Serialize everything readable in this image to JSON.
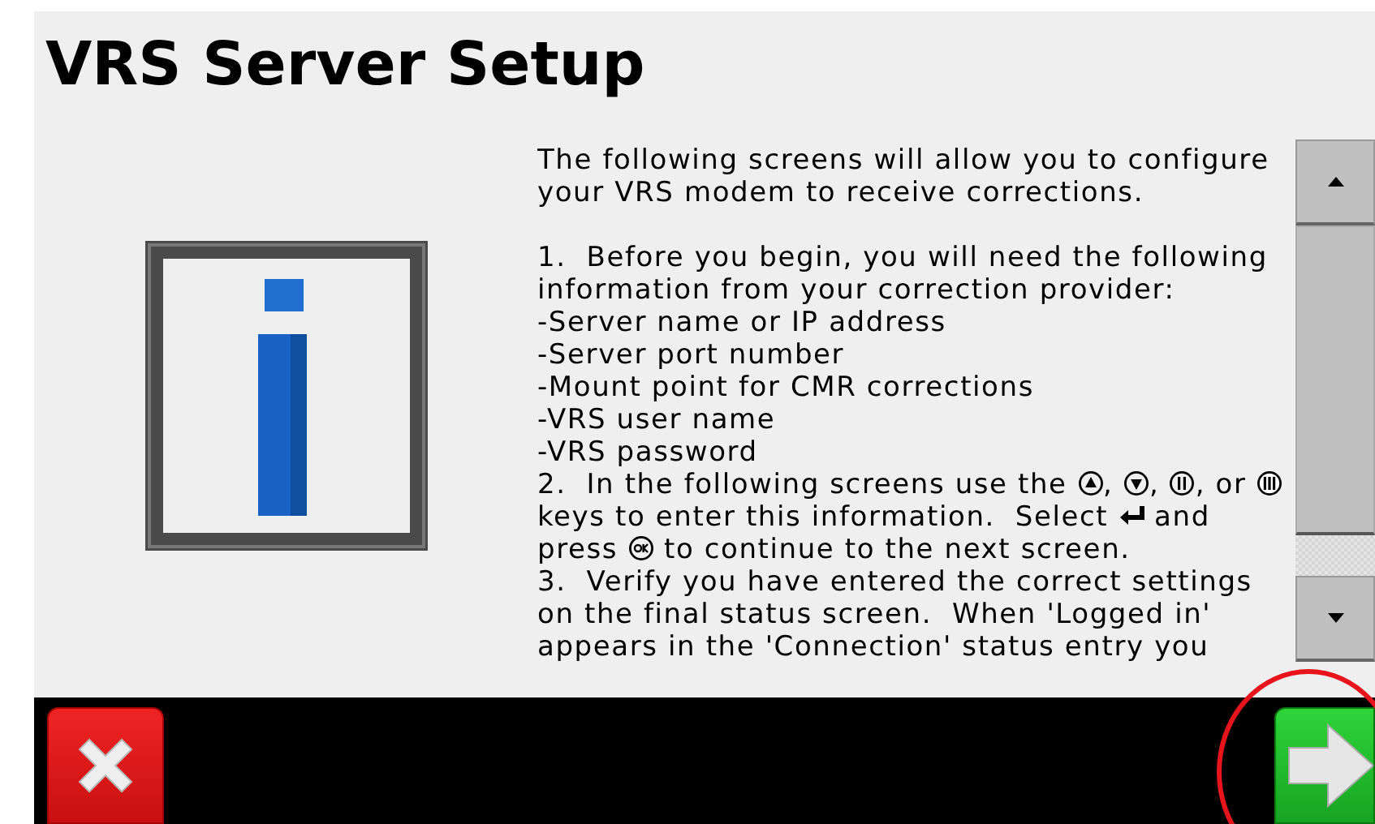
{
  "title": "VRS Server Setup",
  "body": [
    {
      "kind": "intro",
      "segments": [
        {
          "kind": "text",
          "text": "The following screens will allow you to configure your VRS modem to receive corrections."
        }
      ]
    },
    {
      "kind": "line",
      "segments": [
        {
          "kind": "text",
          "text": "1.  Before you begin, you will need the following information from your correction provider:"
        }
      ]
    },
    {
      "kind": "line",
      "segments": [
        {
          "kind": "text",
          "text": "-Server name or IP address"
        }
      ]
    },
    {
      "kind": "line",
      "segments": [
        {
          "kind": "text",
          "text": "-Server port number"
        }
      ]
    },
    {
      "kind": "line",
      "segments": [
        {
          "kind": "text",
          "text": "-Mount point for CMR corrections"
        }
      ]
    },
    {
      "kind": "line",
      "segments": [
        {
          "kind": "text",
          "text": "-VRS user name"
        }
      ]
    },
    {
      "kind": "line",
      "segments": [
        {
          "kind": "text",
          "text": "-VRS password"
        }
      ]
    },
    {
      "kind": "line",
      "segments": [
        {
          "kind": "text",
          "text": "2.  In the following screens use the "
        },
        {
          "kind": "up"
        },
        {
          "kind": "text",
          "text": ", "
        },
        {
          "kind": "down"
        },
        {
          "kind": "text",
          "text": ", "
        },
        {
          "kind": "two"
        },
        {
          "kind": "text",
          "text": ", or "
        },
        {
          "kind": "three"
        },
        {
          "kind": "text",
          "text": " keys to enter this information.  Select "
        },
        {
          "kind": "enter"
        },
        {
          "kind": "text",
          "text": " and press "
        },
        {
          "kind": "ok"
        },
        {
          "kind": "text",
          "text": " to continue to the next screen."
        }
      ]
    },
    {
      "kind": "line",
      "segments": [
        {
          "kind": "text",
          "text": "3.  Verify you have entered the correct settings on the final status screen.  When 'Logged in' appears in the 'Connection' status entry you"
        }
      ]
    }
  ]
}
